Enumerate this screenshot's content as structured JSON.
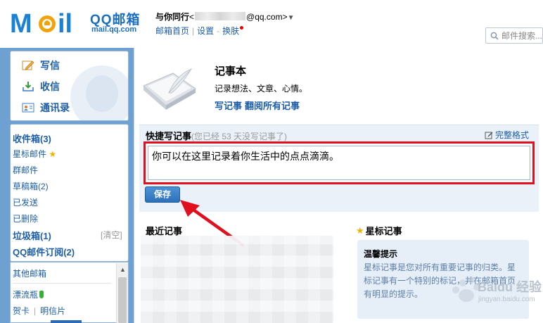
{
  "header": {
    "logo_text": "MOil",
    "brand_cn": "QQ邮箱",
    "brand_domain": "mail.qq.com",
    "greeting": "与你同行",
    "email_prefix": "<",
    "email_suffix": "@qq.com>",
    "caret": "▼",
    "links": {
      "home": "邮箱首页",
      "settings": "设置",
      "skin": "换肤"
    },
    "search_placeholder": "邮件搜索..."
  },
  "compose": {
    "write": "写信",
    "receive": "收信",
    "contacts": "通讯录"
  },
  "folders": {
    "inbox": "收件箱(3)",
    "starred": "星标邮件",
    "group": "群邮件",
    "drafts": "草稿箱(2)",
    "sent": "已发送",
    "deleted": "已删除",
    "spam": "垃圾箱(1)",
    "clear": "[清空]",
    "subscriptions": "QQ邮件订阅(2)",
    "other_mailboxes": "其他邮箱",
    "bottle": "漂流瓶",
    "cards": "贺卡",
    "postcards": "明信片"
  },
  "notebook": {
    "title": "记事本",
    "description": "记录想法、文章、心情。",
    "write_link": "写记事",
    "browse_link": "翻阅所有记事"
  },
  "quick_note": {
    "title": "快捷写记事",
    "hint": "(您已经 53 天没写记事了)",
    "full_format": "完整格式",
    "content": "你可以在这里记录着你生活中的点点滴滴。",
    "save": "保存"
  },
  "recent": {
    "title": "最近记事"
  },
  "starred_notes": {
    "title": "星标记事",
    "tip_title": "温馨提示",
    "tip_body": "星标记事是您对所有重要记事的归类。星标记事有一个特别的标记，并在邮箱首页有明显的提示。"
  },
  "watermark": {
    "text": "Baidu 经验",
    "url": "jingyan.baidu.com"
  },
  "colors": {
    "brand_blue": "#1a6fc0",
    "link_blue": "#1d5ea6",
    "highlight_red": "#e0101e",
    "sidebar_blue": "#6ea0d2"
  }
}
